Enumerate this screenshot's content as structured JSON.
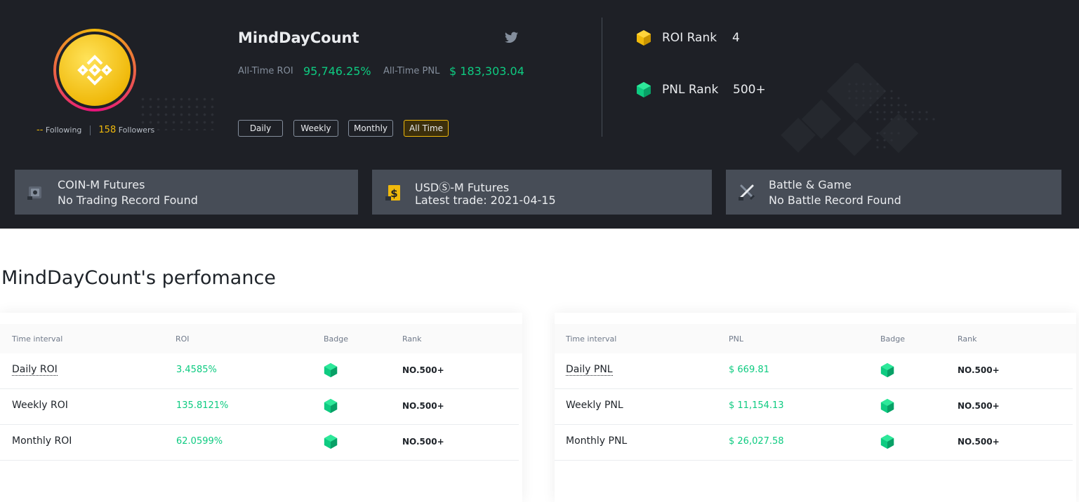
{
  "profile": {
    "username": "MindDayCount",
    "following_count": "--",
    "following_label": "Following",
    "followers_count": "158",
    "followers_label": "Followers",
    "roi_label": "All-Time ROI",
    "roi_value": "95,746.25%",
    "pnl_label": "All-Time PNL",
    "pnl_value": "$ 183,303.04"
  },
  "periods": [
    "Daily",
    "Weekly",
    "Monthly",
    "All Time"
  ],
  "active_period": "All Time",
  "ranks": {
    "roi_label": "ROI Rank",
    "roi_value": "4",
    "pnl_label": "PNL Rank",
    "pnl_value": "500+"
  },
  "cards": [
    {
      "title": "COIN-M Futures",
      "subtitle": "No Trading Record Found",
      "icon": "safe-icon"
    },
    {
      "title": "USDⓈ-M Futures",
      "subtitle": "Latest trade: 2021-04-15",
      "icon": "dollar-icon"
    },
    {
      "title": "Battle & Game",
      "subtitle": "No Battle Record Found",
      "icon": "swords-icon"
    }
  ],
  "performance_title": "MindDayCount's perfomance",
  "roi_table": {
    "headers": [
      "Time interval",
      "ROI",
      "Badge",
      "Rank"
    ],
    "rows": [
      {
        "interval": "Daily ROI",
        "value": "3.4585%",
        "rank": "NO.500+"
      },
      {
        "interval": "Weekly ROI",
        "value": "135.8121%",
        "rank": "NO.500+"
      },
      {
        "interval": "Monthly ROI",
        "value": "62.0599%",
        "rank": "NO.500+"
      }
    ]
  },
  "pnl_table": {
    "headers": [
      "Time interval",
      "PNL",
      "Badge",
      "Rank"
    ],
    "rows": [
      {
        "interval": "Daily PNL",
        "value": "$ 669.81",
        "rank": "NO.500+"
      },
      {
        "interval": "Weekly PNL",
        "value": "$ 11,154.13",
        "rank": "NO.500+"
      },
      {
        "interval": "Monthly PNL",
        "value": "$ 26,027.58",
        "rank": "NO.500+"
      }
    ]
  },
  "colors": {
    "accent": "#f0b90b",
    "positive": "#0ecb81",
    "dark_bg": "#1e2026",
    "card_bg": "#474d57"
  }
}
